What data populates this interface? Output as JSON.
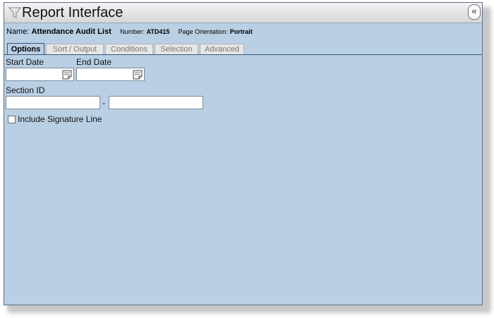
{
  "window": {
    "title": "Report Interface",
    "collapse_label": "«"
  },
  "report": {
    "name_label": "Name:",
    "name_value": "Attendance Audit List",
    "number_label": "Number:",
    "number_value": "ATD415",
    "orientation_label": "Page Orientation:",
    "orientation_value": "Portrait"
  },
  "tabs": [
    {
      "label": "Options",
      "active": true
    },
    {
      "label": "Sort / Output",
      "active": false
    },
    {
      "label": "Conditions",
      "active": false
    },
    {
      "label": "Selection",
      "active": false
    },
    {
      "label": "Advanced",
      "active": false
    }
  ],
  "options": {
    "start_date_label": "Start Date",
    "start_date_value": "",
    "end_date_label": "End Date",
    "end_date_value": "",
    "section_id_label": "Section ID",
    "section_from_value": "",
    "section_separator": "-",
    "section_to_value": "",
    "signature_label": "Include Signature Line",
    "signature_checked": false
  },
  "icons": {
    "title_icon": "funnel-icon",
    "date_picker": "calendar-icon"
  }
}
